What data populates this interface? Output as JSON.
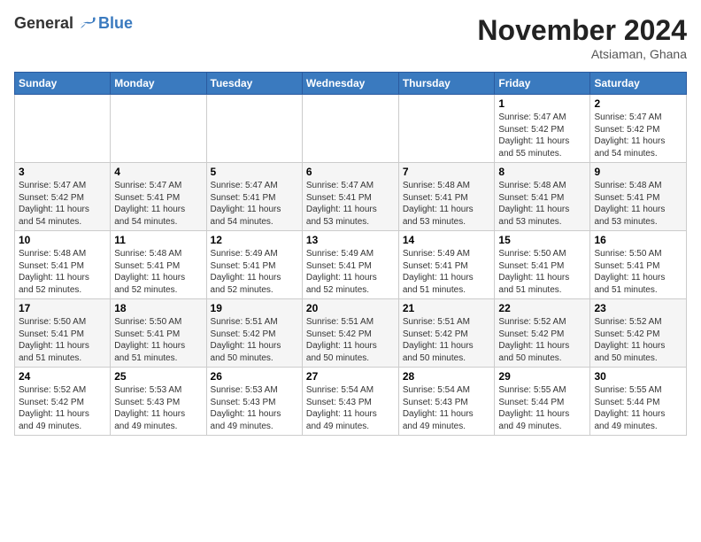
{
  "header": {
    "logo_general": "General",
    "logo_blue": "Blue",
    "month": "November 2024",
    "location": "Atsiaman, Ghana"
  },
  "weekdays": [
    "Sunday",
    "Monday",
    "Tuesday",
    "Wednesday",
    "Thursday",
    "Friday",
    "Saturday"
  ],
  "weeks": [
    [
      {
        "day": "",
        "info": ""
      },
      {
        "day": "",
        "info": ""
      },
      {
        "day": "",
        "info": ""
      },
      {
        "day": "",
        "info": ""
      },
      {
        "day": "",
        "info": ""
      },
      {
        "day": "1",
        "info": "Sunrise: 5:47 AM\nSunset: 5:42 PM\nDaylight: 11 hours\nand 55 minutes."
      },
      {
        "day": "2",
        "info": "Sunrise: 5:47 AM\nSunset: 5:42 PM\nDaylight: 11 hours\nand 54 minutes."
      }
    ],
    [
      {
        "day": "3",
        "info": "Sunrise: 5:47 AM\nSunset: 5:42 PM\nDaylight: 11 hours\nand 54 minutes."
      },
      {
        "day": "4",
        "info": "Sunrise: 5:47 AM\nSunset: 5:41 PM\nDaylight: 11 hours\nand 54 minutes."
      },
      {
        "day": "5",
        "info": "Sunrise: 5:47 AM\nSunset: 5:41 PM\nDaylight: 11 hours\nand 54 minutes."
      },
      {
        "day": "6",
        "info": "Sunrise: 5:47 AM\nSunset: 5:41 PM\nDaylight: 11 hours\nand 53 minutes."
      },
      {
        "day": "7",
        "info": "Sunrise: 5:48 AM\nSunset: 5:41 PM\nDaylight: 11 hours\nand 53 minutes."
      },
      {
        "day": "8",
        "info": "Sunrise: 5:48 AM\nSunset: 5:41 PM\nDaylight: 11 hours\nand 53 minutes."
      },
      {
        "day": "9",
        "info": "Sunrise: 5:48 AM\nSunset: 5:41 PM\nDaylight: 11 hours\nand 53 minutes."
      }
    ],
    [
      {
        "day": "10",
        "info": "Sunrise: 5:48 AM\nSunset: 5:41 PM\nDaylight: 11 hours\nand 52 minutes."
      },
      {
        "day": "11",
        "info": "Sunrise: 5:48 AM\nSunset: 5:41 PM\nDaylight: 11 hours\nand 52 minutes."
      },
      {
        "day": "12",
        "info": "Sunrise: 5:49 AM\nSunset: 5:41 PM\nDaylight: 11 hours\nand 52 minutes."
      },
      {
        "day": "13",
        "info": "Sunrise: 5:49 AM\nSunset: 5:41 PM\nDaylight: 11 hours\nand 52 minutes."
      },
      {
        "day": "14",
        "info": "Sunrise: 5:49 AM\nSunset: 5:41 PM\nDaylight: 11 hours\nand 51 minutes."
      },
      {
        "day": "15",
        "info": "Sunrise: 5:50 AM\nSunset: 5:41 PM\nDaylight: 11 hours\nand 51 minutes."
      },
      {
        "day": "16",
        "info": "Sunrise: 5:50 AM\nSunset: 5:41 PM\nDaylight: 11 hours\nand 51 minutes."
      }
    ],
    [
      {
        "day": "17",
        "info": "Sunrise: 5:50 AM\nSunset: 5:41 PM\nDaylight: 11 hours\nand 51 minutes."
      },
      {
        "day": "18",
        "info": "Sunrise: 5:50 AM\nSunset: 5:41 PM\nDaylight: 11 hours\nand 51 minutes."
      },
      {
        "day": "19",
        "info": "Sunrise: 5:51 AM\nSunset: 5:42 PM\nDaylight: 11 hours\nand 50 minutes."
      },
      {
        "day": "20",
        "info": "Sunrise: 5:51 AM\nSunset: 5:42 PM\nDaylight: 11 hours\nand 50 minutes."
      },
      {
        "day": "21",
        "info": "Sunrise: 5:51 AM\nSunset: 5:42 PM\nDaylight: 11 hours\nand 50 minutes."
      },
      {
        "day": "22",
        "info": "Sunrise: 5:52 AM\nSunset: 5:42 PM\nDaylight: 11 hours\nand 50 minutes."
      },
      {
        "day": "23",
        "info": "Sunrise: 5:52 AM\nSunset: 5:42 PM\nDaylight: 11 hours\nand 50 minutes."
      }
    ],
    [
      {
        "day": "24",
        "info": "Sunrise: 5:52 AM\nSunset: 5:42 PM\nDaylight: 11 hours\nand 49 minutes."
      },
      {
        "day": "25",
        "info": "Sunrise: 5:53 AM\nSunset: 5:43 PM\nDaylight: 11 hours\nand 49 minutes."
      },
      {
        "day": "26",
        "info": "Sunrise: 5:53 AM\nSunset: 5:43 PM\nDaylight: 11 hours\nand 49 minutes."
      },
      {
        "day": "27",
        "info": "Sunrise: 5:54 AM\nSunset: 5:43 PM\nDaylight: 11 hours\nand 49 minutes."
      },
      {
        "day": "28",
        "info": "Sunrise: 5:54 AM\nSunset: 5:43 PM\nDaylight: 11 hours\nand 49 minutes."
      },
      {
        "day": "29",
        "info": "Sunrise: 5:55 AM\nSunset: 5:44 PM\nDaylight: 11 hours\nand 49 minutes."
      },
      {
        "day": "30",
        "info": "Sunrise: 5:55 AM\nSunset: 5:44 PM\nDaylight: 11 hours\nand 49 minutes."
      }
    ]
  ]
}
